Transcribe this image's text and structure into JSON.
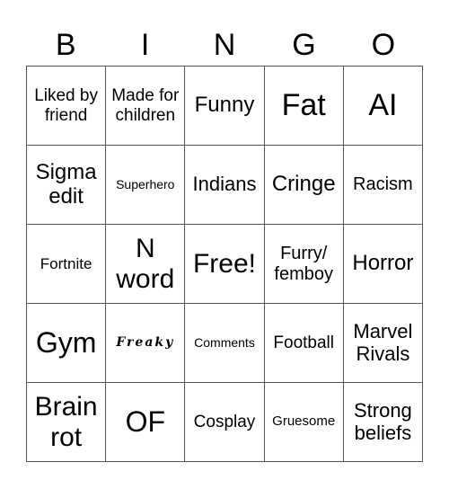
{
  "header": {
    "letters": [
      "B",
      "I",
      "N",
      "G",
      "O"
    ]
  },
  "cells": [
    [
      "Liked by friend",
      "Made for children",
      "Funny",
      "Fat",
      "AI"
    ],
    [
      "Sigma edit",
      "Superhero",
      "Indians",
      "Cringe",
      "Racism"
    ],
    [
      "Fortnite",
      "N word",
      "Free!",
      "Furry/ femboy",
      "Horror"
    ],
    [
      "Gym",
      "Freaky",
      "Comments",
      "Football",
      "Marvel Rivals"
    ],
    [
      "Brain rot",
      "OF",
      "Cosplay",
      "Gruesome",
      "Strong beliefs"
    ]
  ],
  "free_space": {
    "row": 2,
    "col": 2,
    "label": "Free!"
  }
}
